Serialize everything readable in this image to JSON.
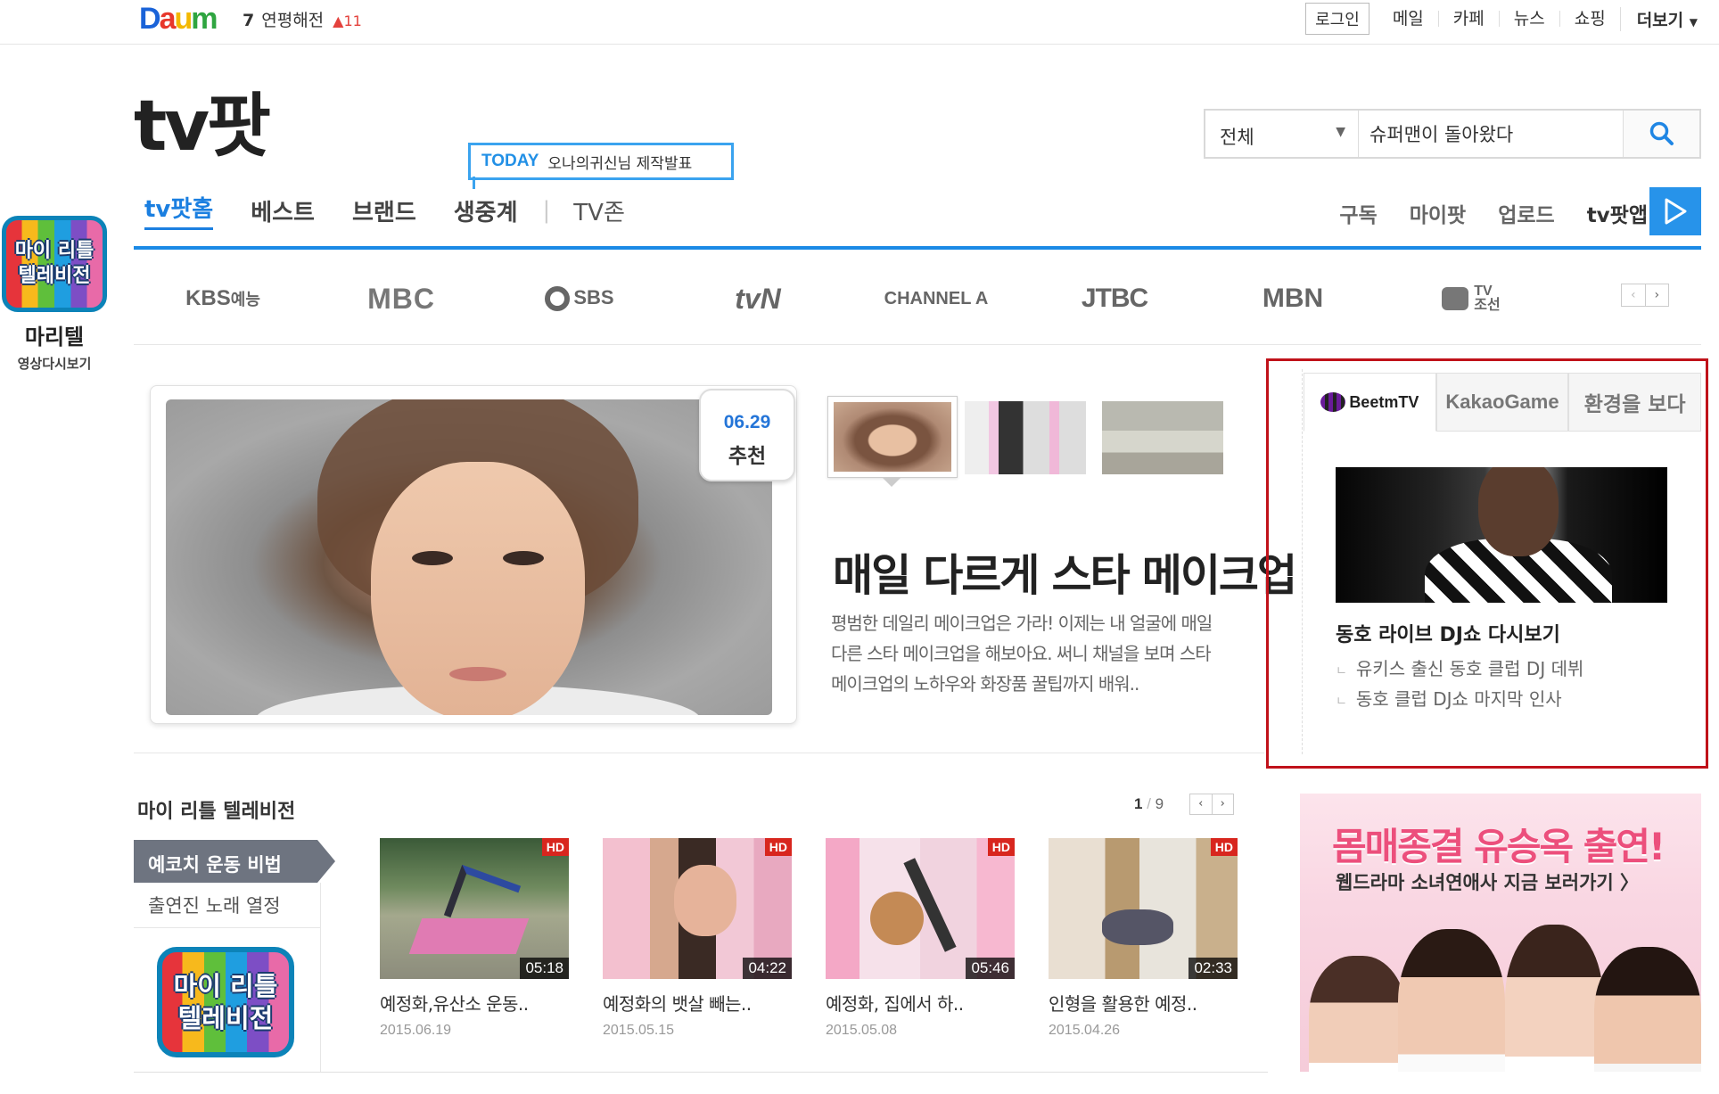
{
  "topbar": {
    "logo_d": "D",
    "logo_a": "a",
    "logo_u": "u",
    "logo_m": "m",
    "rank_num": "7",
    "rank_text": "연평해전",
    "rank_change": "11",
    "login": "로그인",
    "links": [
      "메일",
      "카페",
      "뉴스",
      "쇼핑"
    ],
    "more": "더보기"
  },
  "brand": "tv팟",
  "search": {
    "scope": "전체",
    "value": "슈퍼맨이 돌아왔다"
  },
  "today": {
    "tag": "TODAY",
    "text": "오나의귀신님 제작발표"
  },
  "mainnav": [
    "tv팟홈",
    "베스트",
    "브랜드",
    "생중계",
    "TV존"
  ],
  "subnav": [
    "구독",
    "마이팟",
    "업로드",
    "tv팟앱"
  ],
  "channels": [
    "KBS",
    "예능",
    "MBC",
    "SBS",
    "tvN",
    "CHANNEL A",
    "JTBC",
    "MBN",
    "TV",
    "조선"
  ],
  "side_badge": {
    "line1": "마이 리틀",
    "line2": "텔레비전",
    "label": "마리텔",
    "sub": "영상다시보기"
  },
  "featured": {
    "date": "06.29",
    "tag": "추천",
    "headline": "매일 다르게 스타 메이크업",
    "desc": [
      "평범한 데일리 메이크업은 가라! 이제는 내 얼굴에 매일",
      "다른 스타 메이크업을 해보아요. 써니 채널을 보며 스타",
      "메이크업의 노하우와 화장품 꿀팁까지 배워.."
    ]
  },
  "right_panel": {
    "tabs": [
      "BeetmTV",
      "KakaoGame",
      "환경을 보다"
    ],
    "title": "동호 라이브 DJ쇼 다시보기",
    "lines": [
      "유키스 출신 동호 클럽 DJ 데뷔",
      "동호 클럽 DJ쇼 마지막 인사"
    ]
  },
  "mlt": {
    "title": "마이 리틀 텔레비전",
    "page_current": "1",
    "page_total": "9",
    "tabs": [
      "예코치 운동 비법",
      "출연진 노래 열정"
    ],
    "logo_line1": "마이 리틀",
    "logo_line2": "텔레비전",
    "videos": [
      {
        "title": "예정화,유산소 운동..",
        "date": "2015.06.19",
        "duration": "05:18",
        "badge": "HD"
      },
      {
        "title": "예정화의 뱃살 빼는..",
        "date": "2015.05.15",
        "duration": "04:22",
        "badge": "HD"
      },
      {
        "title": "예정화, 집에서 하..",
        "date": "2015.05.08",
        "duration": "05:46",
        "badge": "HD"
      },
      {
        "title": "인형을 활용한 예정..",
        "date": "2015.04.26",
        "duration": "02:33",
        "badge": "HD"
      }
    ]
  },
  "ad": {
    "headline": "몸매종결 유승옥 출연!",
    "sub": "웹드라마 소녀연애사 지금 보러가기 〉"
  },
  "colors": {
    "accent": "#1b8ae6",
    "highlight_box": "#c0121a",
    "hd_badge": "#d8261e"
  }
}
